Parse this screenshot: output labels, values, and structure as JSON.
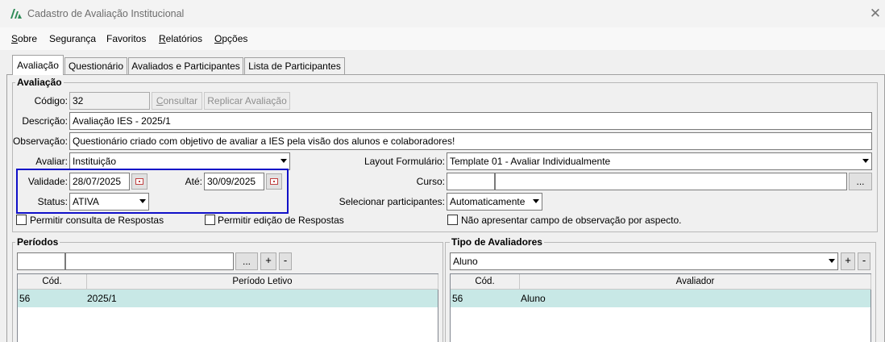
{
  "window": {
    "title": "Cadastro de Avaliação Institucional",
    "close_symbol": "✕"
  },
  "menu": {
    "items": [
      {
        "first": "S",
        "rest": "obre"
      },
      {
        "first": "",
        "rest": "Segurança"
      },
      {
        "first": "",
        "rest": "Favoritos"
      },
      {
        "first": "R",
        "rest": "elatórios"
      },
      {
        "first": "O",
        "rest": "pções"
      }
    ]
  },
  "tabs": [
    "Avaliação",
    "Questionário",
    "Avaliados e Participantes",
    "Lista de Participantes"
  ],
  "avaliacao": {
    "group_title": "Avaliação",
    "codigo_label": "Código:",
    "codigo_value": "32",
    "consultar_label": "Consultar",
    "consultar_first": "C",
    "consultar_rest": "onsultar",
    "replicar_label": "Replicar Avaliação",
    "descricao_label": "Descrição:",
    "descricao_value": "Avaliação IES - 2025/1",
    "observacao_label": "Observação:",
    "observacao_value": "Questionário criado com objetivo de avaliar a IES pela visão dos alunos e colaboradores!",
    "avaliar_label": "Avaliar:",
    "avaliar_value": "Instituição",
    "layout_label": "Layout Formulário:",
    "layout_value": "Template 01 - Avaliar Individualmente",
    "validade_label": "Validade:",
    "validade_value": "28/07/2025",
    "ate_label": "Até:",
    "ate_value": "30/09/2025",
    "curso_label": "Curso:",
    "curso_code": "",
    "curso_name": "",
    "curso_btn": "...",
    "status_label": "Status:",
    "status_value": "ATIVA",
    "selecionar_label": "Selecionar participantes:",
    "selecionar_value": "Automaticamente",
    "chk_consulta": "Permitir consulta de Respostas",
    "chk_edicao": "Permitir edição de Respostas",
    "chk_observacao": "Não apresentar campo de observação por aspecto."
  },
  "periodos": {
    "group_title": "Períodos",
    "search_code": "",
    "search_name": "",
    "btn_lookup": "...",
    "btn_add": "+",
    "btn_remove": "-",
    "columns": [
      "Cód.",
      "Período Letivo"
    ],
    "rows": [
      {
        "cod": "56",
        "periodo": "2025/1"
      }
    ]
  },
  "tipo_avaliadores": {
    "group_title": "Tipo de Avaliadores",
    "select_value": "Aluno",
    "btn_add": "+",
    "btn_remove": "-",
    "columns": [
      "Cód.",
      "Avaliador"
    ],
    "rows": [
      {
        "cod": "56",
        "avaliador": "Aluno"
      }
    ]
  },
  "colors": {
    "highlight_border": "#1010c8",
    "row_selected": "#c8e8e6",
    "logo": "#2e8b57"
  }
}
